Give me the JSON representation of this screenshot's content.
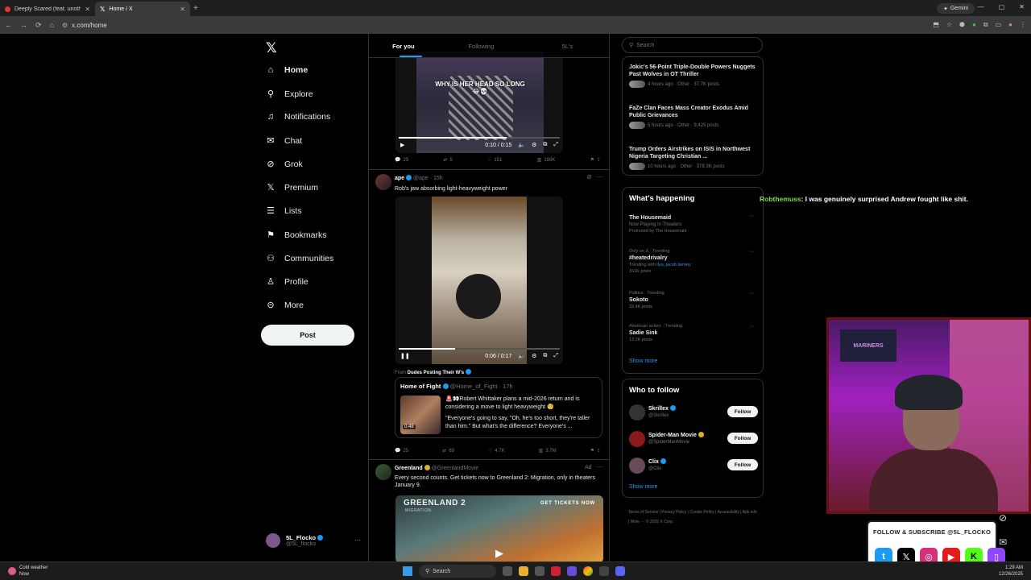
{
  "browser": {
    "tabs": [
      {
        "title": "Deeply Scared (feat. unoth…",
        "active": false
      },
      {
        "title": "Home / X",
        "active": true
      }
    ],
    "new_tab": "+",
    "gemini_label": "Gemini",
    "url": "x.com/home"
  },
  "nav": {
    "items": [
      {
        "label": "Home",
        "icon": "home-icon"
      },
      {
        "label": "Explore",
        "icon": "search-icon"
      },
      {
        "label": "Notifications",
        "icon": "bell-icon"
      },
      {
        "label": "Chat",
        "icon": "mail-icon"
      },
      {
        "label": "Grok",
        "icon": "grok-icon"
      },
      {
        "label": "Premium",
        "icon": "x-icon"
      },
      {
        "label": "Lists",
        "icon": "list-icon"
      },
      {
        "label": "Bookmarks",
        "icon": "bookmark-icon"
      },
      {
        "label": "Communities",
        "icon": "people-icon"
      },
      {
        "label": "Profile",
        "icon": "person-icon"
      },
      {
        "label": "More",
        "icon": "more-circle-icon"
      }
    ],
    "post_label": "Post",
    "account": {
      "name": "5L_Flocko",
      "handle": "@5L_flocko"
    }
  },
  "feed": {
    "tabs": [
      "For you",
      "Following",
      "5L's"
    ],
    "post1": {
      "video_caption": "WHY IS HER HEAD SO LONG 😂💀",
      "time": "0:10 / 0:15",
      "progress": 0.67,
      "replies": "25",
      "reposts": "5",
      "likes": "151",
      "views": "199K"
    },
    "post2": {
      "name": "ape",
      "handle": "@ape",
      "age": "15h",
      "text": "Rob's jaw absorbing light-heavyweight power",
      "time": "0:06 / 0:17",
      "progress": 0.35,
      "from_label": "From",
      "from_name": "Dudes Posting Their W's",
      "quote": {
        "name": "Home of Fight",
        "handle": "@Home_of_Fight",
        "age": "17h",
        "duration": "0:48",
        "text1": "🚨👀Robert Whittaker plans a mid-2026 return and is considering a move to light heavyweight 🧐",
        "text2": "\"Everyone's going to say, \"Oh, he's too short, they're taller than him.\" But what's the difference? Everyone's ..."
      },
      "replies": "25",
      "reposts": "69",
      "likes": "4.7K",
      "views": "3.7M"
    },
    "post3": {
      "name": "Greenland",
      "handle": "@GreenlandMovie",
      "ad": "Ad",
      "text": "Every second counts. Get tickets now to Greenland 2: Migration, only in theaters January 9.",
      "banner_title": "GREENLAND 2",
      "banner_sub": "MIGRATION",
      "banner_cta": "GET TICKETS NOW"
    }
  },
  "right": {
    "search_placeholder": "Search",
    "news": [
      {
        "title": "Jokic's 56-Point Triple-Double Powers Nuggets Past Wolves in OT Thriller",
        "meta": "4 hours ago · Other · 37.7K posts"
      },
      {
        "title": "FaZe Clan Faces Mass Creator Exodus Amid Public Grievances",
        "meta": "5 hours ago · Other · 9,429 posts"
      },
      {
        "title": "Trump Orders Airstrikes on ISIS in Northwest Nigeria Targeting Christian ...",
        "meta": "10 hours ago · Other · 378.3K posts"
      }
    ],
    "happening_title": "What's happening",
    "trends": [
      {
        "cat": "",
        "name": "The Housemaid",
        "sub": "Now Playing In Theaters",
        "sub2": "Promoted by The Housemaid"
      },
      {
        "cat": "Only on X · Trending",
        "name": "#heatedrivalry",
        "sub": "Trending with ",
        "sub_link": "ilya, jacob tierney",
        "sub2": "161K posts"
      },
      {
        "cat": "Politics · Trending",
        "name": "Sokoto",
        "sub": "33.4K posts",
        "sub2": ""
      },
      {
        "cat": "American actors · Trending",
        "name": "Sadie Sink",
        "sub": "13.2K posts",
        "sub2": ""
      }
    ],
    "show_more": "Show more",
    "follow_title": "Who to follow",
    "follow": [
      {
        "name": "Skrillex",
        "handle": "@Skrillex",
        "btn": "Follow",
        "color": "#333333"
      },
      {
        "name": "Spider-Man Movie",
        "handle": "@SpiderManMovie",
        "btn": "Follow",
        "color": "#8a1a1a"
      },
      {
        "name": "Clix",
        "handle": "@Clix",
        "btn": "Follow",
        "color": "#6a4a5a"
      }
    ],
    "footer": "Terms of Service  |  Privacy Policy  |  Cookie Policy  |  Accessibility  |  Ads info  |  More ···  © 2025 X Corp."
  },
  "overlay": {
    "chat_user": "Robthemuss",
    "chat_msg": ": I was genuinely surprised Andrew fought like shit.",
    "webcam_sign": "MARINERS",
    "follow_banner": "FOLLOW & SUBSCRIBE @5L_FLOCKO"
  },
  "taskbar": {
    "weather_title": "Cold weather",
    "weather_sub": "Now",
    "search": "Search",
    "time": "1:29 AM",
    "date": "12/26/2025"
  }
}
